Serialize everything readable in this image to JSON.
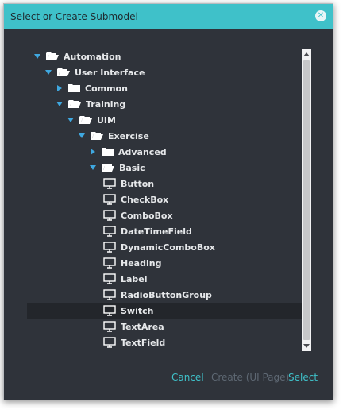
{
  "dialog": {
    "title": "Select or Create Submodel",
    "close_icon": "close-circle-icon"
  },
  "colors": {
    "titlebar": "#3fc1c9",
    "background": "#2f333a",
    "accent": "#3fc1c9",
    "disabled": "#5e6873",
    "tree_arrow": "#3fa8e0",
    "selected_row": "#23262b"
  },
  "tree": {
    "nodes": [
      {
        "label": "Automation",
        "depth": 0,
        "kind": "folder-open",
        "expanded": true
      },
      {
        "label": "User Interface",
        "depth": 1,
        "kind": "folder-open",
        "expanded": true
      },
      {
        "label": "Common",
        "depth": 2,
        "kind": "folder-closed",
        "expanded": false
      },
      {
        "label": "Training",
        "depth": 2,
        "kind": "folder-open",
        "expanded": true
      },
      {
        "label": "UIM",
        "depth": 3,
        "kind": "folder-open",
        "expanded": true
      },
      {
        "label": "Exercise",
        "depth": 4,
        "kind": "folder-open",
        "expanded": true
      },
      {
        "label": "Advanced",
        "depth": 5,
        "kind": "folder-closed",
        "expanded": false
      },
      {
        "label": "Basic",
        "depth": 5,
        "kind": "folder-open",
        "expanded": true
      },
      {
        "label": "Button",
        "depth": 6,
        "kind": "leaf"
      },
      {
        "label": "CheckBox",
        "depth": 6,
        "kind": "leaf"
      },
      {
        "label": "ComboBox",
        "depth": 6,
        "kind": "leaf"
      },
      {
        "label": "DateTimeField",
        "depth": 6,
        "kind": "leaf"
      },
      {
        "label": "DynamicComboBox",
        "depth": 6,
        "kind": "leaf"
      },
      {
        "label": "Heading",
        "depth": 6,
        "kind": "leaf"
      },
      {
        "label": "Label",
        "depth": 6,
        "kind": "leaf"
      },
      {
        "label": "RadioButtonGroup",
        "depth": 6,
        "kind": "leaf"
      },
      {
        "label": "Switch",
        "depth": 6,
        "kind": "leaf",
        "selected": true
      },
      {
        "label": "TextArea",
        "depth": 6,
        "kind": "leaf"
      },
      {
        "label": "TextField",
        "depth": 6,
        "kind": "leaf"
      }
    ]
  },
  "footer": {
    "cancel_label": "Cancel",
    "create_label": "Create (UI Page)",
    "select_label": "Select"
  }
}
